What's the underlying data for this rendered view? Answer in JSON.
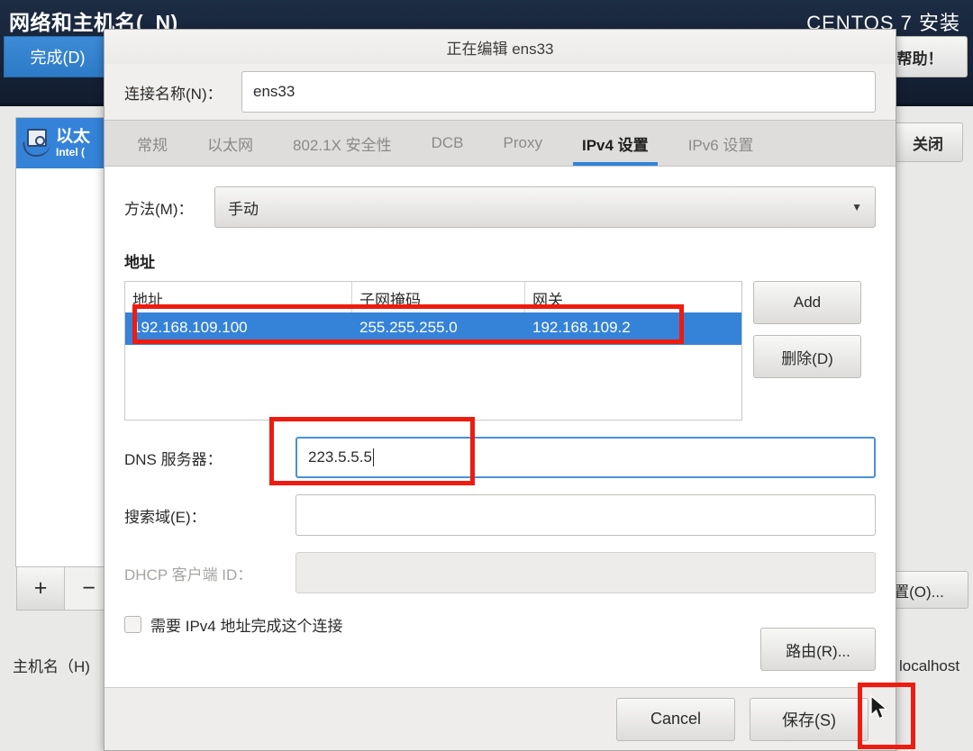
{
  "installer": {
    "title": "网络和主机名(_N)",
    "brand": "CENTOS 7 安装",
    "done_label": "完成(D)",
    "help_label": "帮助！",
    "close_label": "关闭",
    "configure_label": "置(O)...",
    "hostname_label": "主机名（H)",
    "hostname_value": "localhost",
    "device": {
      "name": "以太",
      "sub": "Intel (",
      "icon": "ethernet-icon"
    },
    "add_device_label": "+",
    "remove_device_label": "−"
  },
  "dialog": {
    "title": "正在编辑 ens33",
    "connection_name_label": "连接名称(N)：",
    "connection_name_value": "ens33",
    "tabs": [
      {
        "label": "常规",
        "active": false
      },
      {
        "label": "以太网",
        "active": false
      },
      {
        "label": "802.1X 安全性",
        "active": false
      },
      {
        "label": "DCB",
        "active": false
      },
      {
        "label": "Proxy",
        "active": false
      },
      {
        "label": "IPv4 设置",
        "active": true
      },
      {
        "label": "IPv6 设置",
        "active": false
      }
    ],
    "method_label": "方法(M)：",
    "method_value": "手动",
    "method_caret": "chevron-down-icon",
    "addresses_section_title": "地址",
    "addresses_table": {
      "columns": [
        "地址",
        "子网掩码",
        "网关"
      ],
      "rows": [
        [
          "192.168.109.100",
          "255.255.255.0",
          "192.168.109.2"
        ]
      ]
    },
    "add_button_label": "Add",
    "delete_button_label": "删除(D)",
    "dns_label": "DNS 服务器：",
    "dns_value": "223.5.5.5",
    "search_domain_label": "搜索域(E)：",
    "search_domain_value": "",
    "dhcp_client_id_label": "DHCP 客户端 ID：",
    "dhcp_client_id_value": "",
    "require_ipv4_label": "需要 IPv4 地址完成这个连接",
    "require_ipv4_checked": false,
    "routes_button_label": "路由(R)...",
    "cancel_button_label": "Cancel",
    "save_button_label": "保存(S)"
  },
  "annotations": {
    "color": "#ee1b10",
    "boxes": [
      "address-row-highlight",
      "dns-field-highlight",
      "save-button-highlight"
    ]
  },
  "colors": {
    "accent_blue": "#3583d8",
    "header_dark": "#17243a",
    "annotation_red": "#ee1b10"
  }
}
